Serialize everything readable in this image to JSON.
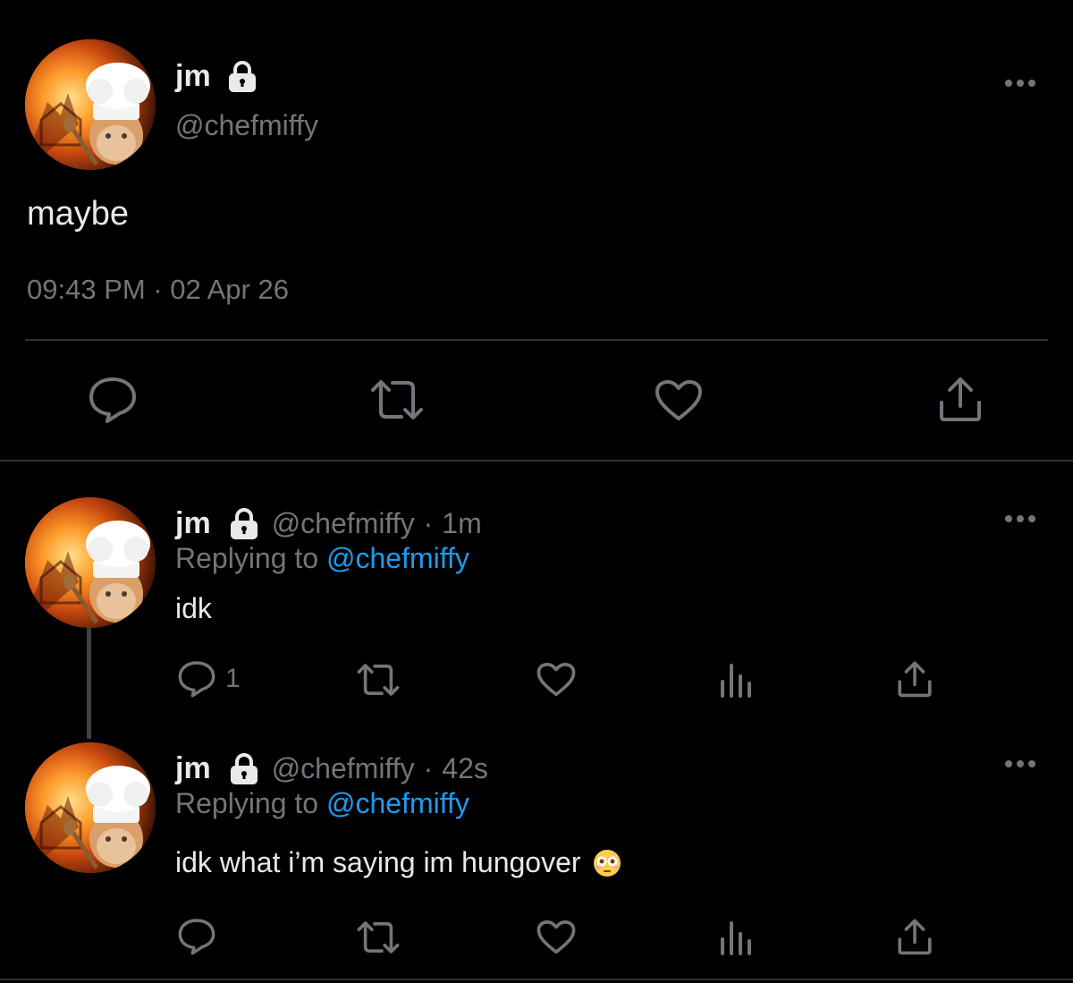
{
  "main_tweet": {
    "display_name": "jm",
    "handle": "@chefmiffy",
    "text": "maybe",
    "timestamp": "09:43 PM · 02 Apr 26",
    "actions": [
      "reply-icon",
      "retweet-icon",
      "like-icon",
      "share-icon"
    ]
  },
  "replies": [
    {
      "display_name": "jm",
      "handle": "@chefmiffy",
      "separator": "·",
      "time": "1m",
      "replying_prefix": "Replying to",
      "replying_mention": "@chefmiffy",
      "text": "idk",
      "reply_count": "1",
      "actions": [
        "reply-icon",
        "retweet-icon",
        "like-icon",
        "views-icon",
        "share-icon"
      ]
    },
    {
      "display_name": "jm",
      "handle": "@chefmiffy",
      "separator": "·",
      "time": "42s",
      "replying_prefix": "Replying to",
      "replying_mention": "@chefmiffy",
      "text": "idk what i’m saying im hungover",
      "emoji": "flushed-face",
      "actions": [
        "reply-icon",
        "retweet-icon",
        "like-icon",
        "views-icon",
        "share-icon"
      ]
    }
  ],
  "colors": {
    "background": "#000000",
    "text": "#e7e9ea",
    "secondary": "#71767b",
    "accent": "#1d9bf0",
    "divider": "#2f3336"
  }
}
